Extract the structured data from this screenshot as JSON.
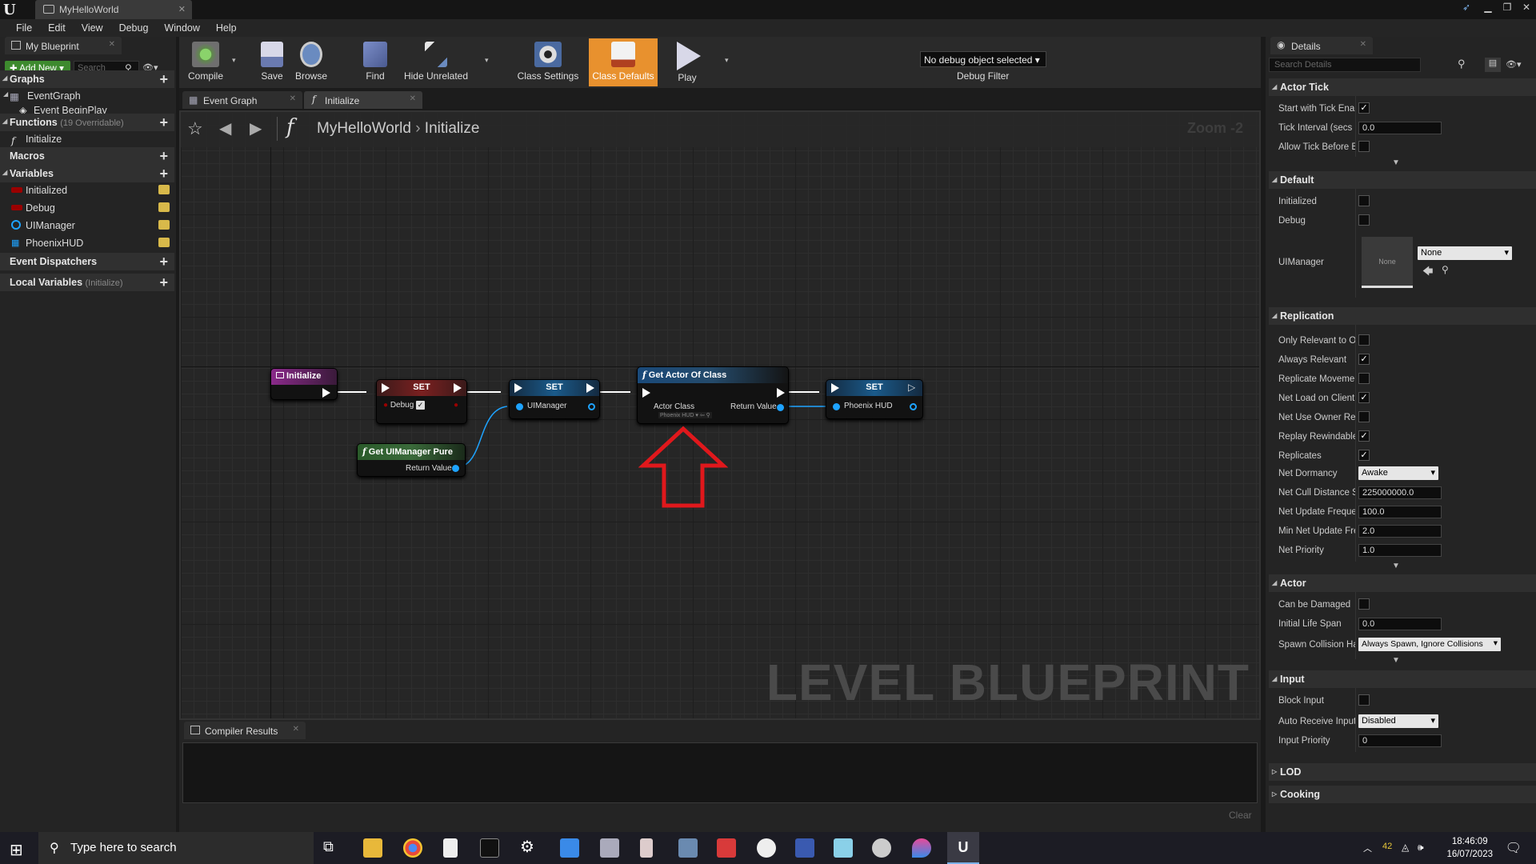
{
  "window": {
    "tab_title": "MyHelloWorld"
  },
  "menu": [
    "File",
    "Edit",
    "View",
    "Debug",
    "Window",
    "Help"
  ],
  "my_blueprint": {
    "tab": "My Blueprint",
    "add_new": "Add New",
    "search_placeholder": "Search",
    "graphs": {
      "title": "Graphs",
      "items": [
        "EventGraph",
        "Event BeginPlay"
      ]
    },
    "functions": {
      "title": "Functions",
      "sub": "(19 Overridable)",
      "items": [
        "Initialize"
      ]
    },
    "macros": {
      "title": "Macros"
    },
    "variables": {
      "title": "Variables",
      "items": [
        {
          "name": "Initialized",
          "color": "#9a0000"
        },
        {
          "name": "Debug",
          "color": "#9a0000"
        },
        {
          "name": "UIManager",
          "color": "#1ea3ff"
        },
        {
          "name": "PhoenixHUD",
          "color": "#1ea3ff"
        }
      ]
    },
    "event_dispatchers": {
      "title": "Event Dispatchers"
    },
    "local_variables": {
      "title": "Local Variables",
      "sub": "(Initialize)"
    }
  },
  "toolbar": {
    "compile": "Compile",
    "save": "Save",
    "browse": "Browse",
    "find": "Find",
    "hide_unrelated": "Hide Unrelated",
    "class_settings": "Class Settings",
    "class_defaults": "Class Defaults",
    "play": "Play",
    "debug_select": "No debug object selected",
    "debug_filter": "Debug Filter"
  },
  "graph_tabs": [
    "Event Graph",
    "Initialize"
  ],
  "graph": {
    "breadcrumb_root": "MyHelloWorld",
    "breadcrumb_current": "Initialize",
    "zoom": "Zoom -2",
    "watermark": "LEVEL BLUEPRINT",
    "nodes": {
      "initialize": "Initialize",
      "set1": "SET",
      "set1_pin": "Debug",
      "set2": "SET",
      "set2_pin": "UIManager",
      "get_actor": "Get Actor Of Class",
      "get_actor_in": "Actor Class",
      "get_actor_class": "Phoenix HUD",
      "get_actor_out": "Return Value",
      "set3": "SET",
      "set3_pin": "Phoenix HUD",
      "get_ui": "Get UIManager Pure",
      "get_ui_out": "Return Value"
    }
  },
  "compiler": {
    "tab": "Compiler Results",
    "clear": "Clear"
  },
  "details": {
    "tab": "Details",
    "search_placeholder": "Search Details",
    "actor_tick": {
      "title": "Actor Tick",
      "start_with_tick": "Start with Tick Ena",
      "tick_interval": "Tick Interval (secs",
      "tick_interval_val": "0.0",
      "allow_tick": "Allow Tick Before E"
    },
    "default": {
      "title": "Default",
      "initialized": "Initialized",
      "debug": "Debug",
      "uimanager": "UIManager",
      "uimanager_thumb": "None",
      "uimanager_val": "None"
    },
    "replication": {
      "title": "Replication",
      "rows": [
        {
          "label": "Only Relevant to O",
          "checked": false
        },
        {
          "label": "Always Relevant",
          "checked": true
        },
        {
          "label": "Replicate Moveme",
          "checked": false
        },
        {
          "label": "Net Load on Client",
          "checked": true
        },
        {
          "label": "Net Use Owner Rel",
          "checked": false
        },
        {
          "label": "Replay Rewindable",
          "checked": true
        },
        {
          "label": "Replicates",
          "checked": true
        }
      ],
      "net_dormancy": "Net Dormancy",
      "net_dormancy_val": "Awake",
      "net_cull": "Net Cull Distance S",
      "net_cull_val": "225000000.0",
      "net_update": "Net Update Freque",
      "net_update_val": "100.0",
      "min_net": "Min Net Update Fre",
      "min_net_val": "2.0",
      "net_priority": "Net Priority",
      "net_priority_val": "1.0"
    },
    "actor": {
      "title": "Actor",
      "can_damage": "Can be Damaged",
      "life_span": "Initial Life Span",
      "life_span_val": "0.0",
      "spawn": "Spawn Collision Ha",
      "spawn_val": "Always Spawn, Ignore Collisions"
    },
    "input": {
      "title": "Input",
      "block": "Block Input",
      "auto_receive": "Auto Receive Input",
      "auto_receive_val": "Disabled",
      "priority": "Input Priority",
      "priority_val": "0"
    },
    "lod": {
      "title": "LOD"
    },
    "cooking": {
      "title": "Cooking"
    }
  },
  "taskbar": {
    "search_placeholder": "Type here to search",
    "time": "18:46:09",
    "date": "16/07/2023",
    "temp": "42"
  }
}
